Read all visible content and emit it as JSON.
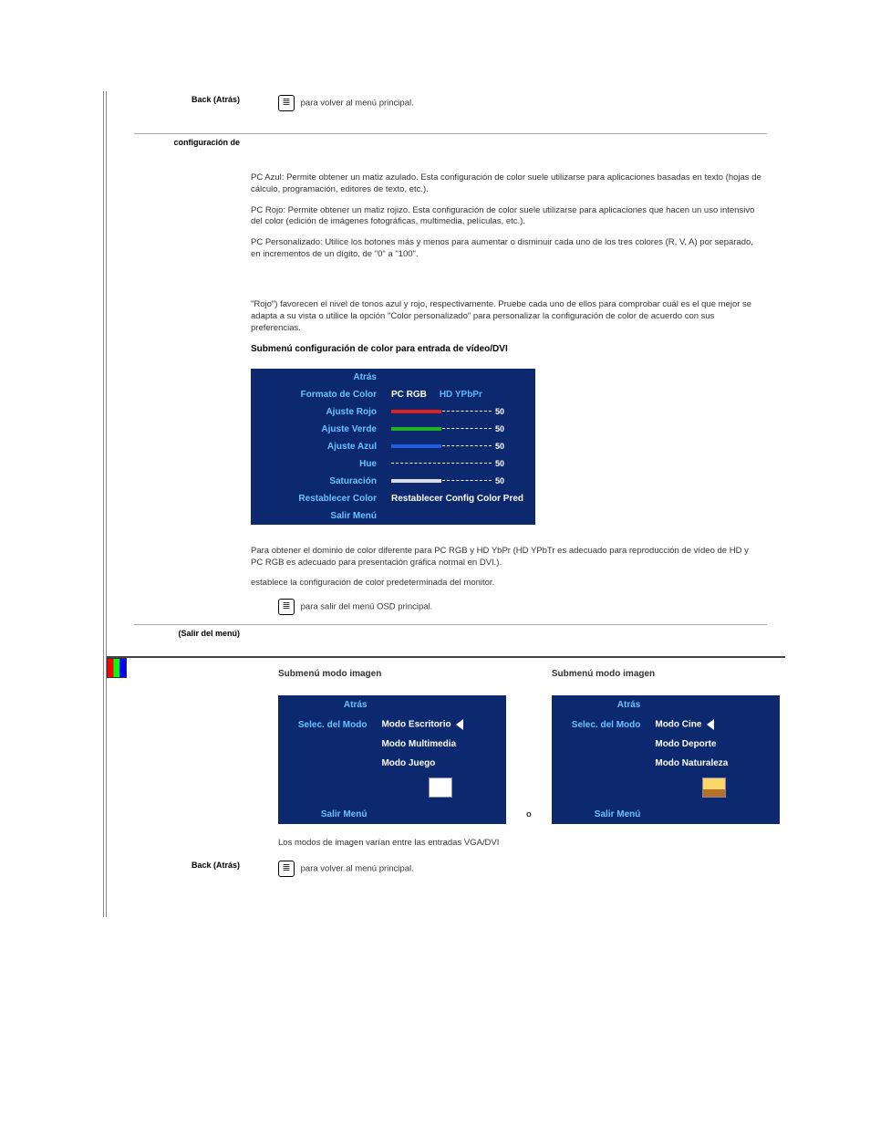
{
  "section1": {
    "back_label": "Back (Atrás)",
    "back_text": "para volver al menú principal.",
    "config_label": "configuración de",
    "p_azul": "PC Azul: Permite obtener un matiz azulado. Esta configuración de color suele utilizarse para aplicaciones basadas en texto (hojas de cálculo, programación, editores de texto, etc.).",
    "p_rojo": "PC Rojo: Permite obtener un matiz rojizo. Esta configuración de color suele utilizarse para aplicaciones que hacen un uso intensivo del color (edición de imágenes fotográficas, multimedia, películas, etc.).",
    "p_pers": "PC Personalizado: Utilice los botones más y menos para aumentar o disminuir cada uno de los tres colores (R, V, A) por separado, en incrementos de un dígito, de \"0\" a \"100\".",
    "p_rojoinfo": "\"Rojo\") favorecen el nivel de tonos azul y rojo, respectivamente. Pruebe cada uno de ellos para comprobar cuál es el que mejor se adapta a su vista o utilice la opción \"Color personalizado\" para personalizar la configuración de color de acuerdo con sus preferencias.",
    "submenu_heading": "Submenú configuración de color para entrada de vídeo/DVI",
    "footer_para": "Para obtener el dominio de color diferente para PC RGB y HD YbPr (HD YPbTr es adecuado para reproducción de vídeo de HD y PC RGB es adecuado para presentación gráfica normal en DVI.).",
    "footer_establece": "establece la configuración de color predeterminada del monitor.",
    "footer_exit": "para salir del menú OSD principal.",
    "salir_label": "(Salir del menú)"
  },
  "osd_color": {
    "atras": "Atrás",
    "formato": "Formato de Color",
    "pc_rgb": "PC RGB",
    "hd_ypbpr": "HD YPbPr",
    "ajuste_rojo": "Ajuste Rojo",
    "ajuste_verde": "Ajuste Verde",
    "ajuste_azul": "Ajuste Azul",
    "hue": "Hue",
    "saturacion": "Saturación",
    "restablecer": "Restablecer Color",
    "restablecer_val": "Restablecer Config Color Pred",
    "salir": "Salir Menú",
    "slider_val": "50"
  },
  "section2": {
    "submenu_heading": "Submenú modo imagen",
    "o": "o",
    "note": "Los modos de imagen varían entre las entradas VGA/DVI",
    "back_label": "Back (Atrás)",
    "back_text": "para volver al menú principal."
  },
  "osd_mode_left": {
    "atras": "Atrás",
    "selec": "Selec. del Modo",
    "modo_escritorio": "Modo Escritorio",
    "modo_multimedia": "Modo Multimedia",
    "modo_juego": "Modo Juego",
    "salir": "Salir Menú"
  },
  "osd_mode_right": {
    "atras": "Atrás",
    "selec": "Selec. del Modo",
    "modo_cine": "Modo Cine",
    "modo_deporte": "Modo Deporte",
    "modo_naturaleza": "Modo Naturaleza",
    "salir": "Salir Menú"
  }
}
